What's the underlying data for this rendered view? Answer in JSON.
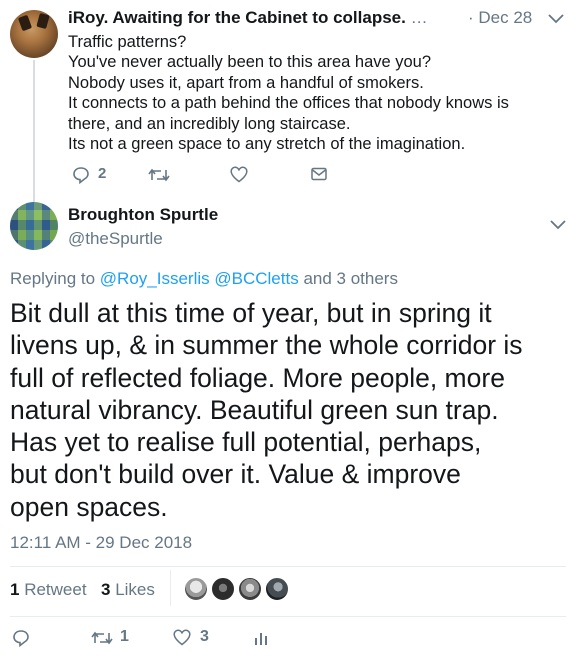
{
  "parent_tweet": {
    "author_name": "iRoy. Awaiting for the Cabinet to collapse.",
    "ellipsis": "…",
    "date": "· Dec 28",
    "lines": [
      "Traffic patterns?",
      "You've never actually been to this area have you?",
      "Nobody uses it, apart from a handful of smokers.",
      "It connects to a path behind the offices that nobody knows is",
      "there, and an incredibly long staircase.",
      "Its not a green space to any stretch of the imagination."
    ],
    "reply_count": "2"
  },
  "focal_tweet": {
    "author_name": "Broughton Spurtle",
    "handle": "@theSpurtle",
    "replying_prefix": "Replying to",
    "replying_user1": "@Roy_Isserlis",
    "replying_user2": "@BCCletts",
    "replying_suffix": "and 3 others",
    "body_lines": [
      "Bit dull at this time of year, but in spring it",
      "livens up, & in summer the whole corridor is",
      "full of reflected foliage. More people, more",
      "natural vibrancy. Beautiful green sun trap.",
      "Has yet to realise full potential, perhaps,",
      "but don't build over it. Value & improve",
      "open spaces."
    ],
    "timestamp": "12:11 AM - 29 Dec 2018",
    "retweet_count": "1",
    "retweet_label": "Retweet",
    "likes_count": "3",
    "likes_label": "Likes",
    "action_retweet_count": "1",
    "action_like_count": "3"
  },
  "colors": {
    "link": "#1da1f2",
    "secondary_text": "#657786",
    "divider": "#e6ecf0"
  }
}
